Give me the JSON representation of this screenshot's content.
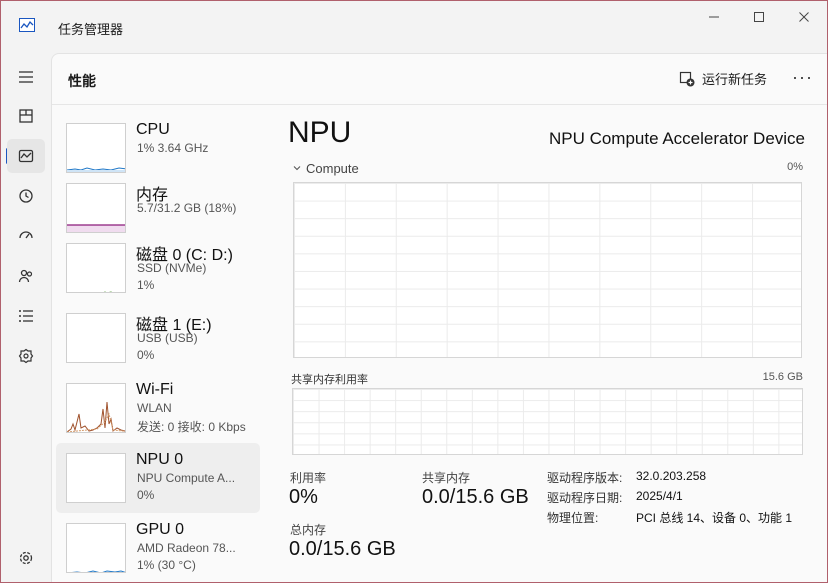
{
  "window": {
    "title": "任务管理器",
    "controls": {
      "minimize": "—",
      "maximize": "☐",
      "close": "✕"
    }
  },
  "header": {
    "title": "性能",
    "run_task_label": "运行新任务",
    "more_label": "···"
  },
  "devices": [
    {
      "name": "CPU",
      "sub1": "1% 3.64 GHz",
      "sub2": "",
      "sub3": ""
    },
    {
      "name": "内存",
      "sub1": "5.7/31.2 GB (18%)",
      "sub2": "",
      "sub3": ""
    },
    {
      "name": "磁盘 0 (C: D:)",
      "sub1": "SSD (NVMe)",
      "sub2": "1%",
      "sub3": ""
    },
    {
      "name": "磁盘 1 (E:)",
      "sub1": "USB (USB)",
      "sub2": "0%",
      "sub3": ""
    },
    {
      "name": "Wi-Fi",
      "sub1": "WLAN",
      "sub2": "发送: 0 接收: 0 Kbps",
      "sub3": ""
    },
    {
      "name": "NPU 0",
      "sub1": "NPU Compute A...",
      "sub2": "0%",
      "sub3": ""
    },
    {
      "name": "GPU 0",
      "sub1": "AMD Radeon 78...",
      "sub2": "1% (30 °C)",
      "sub3": ""
    }
  ],
  "detail": {
    "title": "NPU",
    "device_name": "NPU Compute Accelerator Device",
    "graph1_label": "Compute",
    "graph1_max": "0%",
    "graph2_label": "共享内存利用率",
    "graph2_max": "15.6 GB",
    "stats": {
      "utilization_label": "利用率",
      "utilization_value": "0%",
      "shared_mem_label": "共享内存",
      "shared_mem_value": "0.0/15.6 GB",
      "total_mem_label": "总内存",
      "total_mem_value": "0.0/15.6 GB"
    },
    "properties": {
      "driver_version_label": "驱动程序版本:",
      "driver_version_value": "32.0.203.258",
      "driver_date_label": "驱动程序日期:",
      "driver_date_value": "2025/4/1",
      "location_label": "物理位置:",
      "location_value": "PCI 总线 14、设备 0、功能 1"
    }
  },
  "colors": {
    "cpu": "#1f78c8",
    "memory": "#8b1a7a",
    "disk": "#4c9a2a",
    "wifi": "#a0522d",
    "gpu": "#1f78c8",
    "accent": "#1a56c0"
  },
  "icons": {
    "app": "taskmgr-icon",
    "rail": [
      "hamburger-icon",
      "processes-icon",
      "performance-icon",
      "app-history-icon",
      "startup-icon",
      "users-icon",
      "details-icon",
      "services-icon",
      "settings-icon"
    ]
  }
}
